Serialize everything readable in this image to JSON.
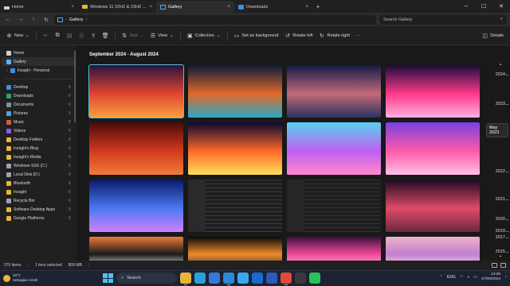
{
  "tabs": [
    {
      "label": "Home",
      "icon": "home-icon",
      "active": false
    },
    {
      "label": "Windows 11 22H2 & 23H2 Feat",
      "icon": "folder-icon",
      "active": false
    },
    {
      "label": "Gallery",
      "icon": "gallery-icon",
      "active": true
    },
    {
      "label": "Downloads",
      "icon": "downloads-icon",
      "active": false
    }
  ],
  "address": {
    "path": "Gallery",
    "search_placeholder": "Search Gallery"
  },
  "commands": {
    "new": "New",
    "sort": "Sort",
    "view": "View",
    "collection": "Collection",
    "set_background": "Set as background",
    "rotate_left": "Rotate left",
    "rotate_right": "Rotate right",
    "more": "···",
    "details": "Details"
  },
  "sidebar": {
    "top": [
      {
        "label": "Home",
        "icon": "home-icon",
        "color": "#d0d0d0",
        "active": false
      },
      {
        "label": "Gallery",
        "icon": "gallery-icon",
        "color": "#5ab0ff",
        "active": true
      },
      {
        "label": "Inzaghi - Personal",
        "icon": "onedrive-icon",
        "color": "#3e8ede",
        "active": false
      }
    ],
    "pinned": [
      {
        "label": "Desktop",
        "color": "#3e8ede"
      },
      {
        "label": "Downloads",
        "color": "#2fa36b"
      },
      {
        "label": "Documents",
        "color": "#7a8fa6"
      },
      {
        "label": "Pictures",
        "color": "#4da3e0"
      },
      {
        "label": "Music",
        "color": "#e0573e"
      },
      {
        "label": "Videos",
        "color": "#8a5ce0"
      },
      {
        "label": "Desktop Folders",
        "color": "#e8b53a"
      },
      {
        "label": "Inzaghi's Blog",
        "color": "#e8b53a"
      },
      {
        "label": "Inzaghi's Media",
        "color": "#e8b53a"
      },
      {
        "label": "Windows-SSD (C:)",
        "color": "#9aa4b0"
      },
      {
        "label": "Local Disk (D:)",
        "color": "#9aa4b0"
      },
      {
        "label": "Bluetooth",
        "color": "#e8b53a"
      },
      {
        "label": "Inzaghi",
        "color": "#e8b53a"
      },
      {
        "label": "Recycle Bin",
        "color": "#9aa4b0"
      },
      {
        "label": "Software Desktop Apps",
        "color": "#e8b53a"
      },
      {
        "label": "Google Platforms",
        "color": "#e8b53a"
      }
    ]
  },
  "main": {
    "section_title": "September 2024 - August 2024",
    "thumbnails": [
      {
        "name": "sunset-palms",
        "c1": "#2a1240",
        "c2": "#e0462e",
        "c3": "#f7a040",
        "selected": true
      },
      {
        "name": "forest-night-lake",
        "c1": "#0c1a3a",
        "c2": "#e06a2a",
        "c3": "#2aa8c8",
        "selected": false
      },
      {
        "name": "mountain-dusk",
        "c1": "#141a48",
        "c2": "#c46a7a",
        "c3": "#2a3160",
        "selected": false
      },
      {
        "name": "retro-sun-palms",
        "c1": "#1a0a3a",
        "c2": "#ff3a8a",
        "c3": "#ffb0e0",
        "selected": false
      },
      {
        "name": "red-sunset-sea",
        "c1": "#4a0a0a",
        "c2": "#d43a1e",
        "c3": "#f07a3a",
        "selected": false
      },
      {
        "name": "neon-triangle",
        "c1": "#0a0630",
        "c2": "#ff6a2a",
        "c3": "#ffe05a",
        "selected": false
      },
      {
        "name": "pastel-wave",
        "c1": "#5ad0f0",
        "c2": "#c060f0",
        "c3": "#ff8ad0",
        "selected": false
      },
      {
        "name": "purple-wave",
        "c1": "#7a40e0",
        "c2": "#ff5aa8",
        "c3": "#ffc0e8",
        "selected": false
      },
      {
        "name": "blue-wave",
        "c1": "#0a1a6a",
        "c2": "#4a7af0",
        "c3": "#d080ff",
        "selected": false
      },
      {
        "name": "code-screenshot-1",
        "c1": "#1e1e1e",
        "c2": "#2a2a2a",
        "c3": "#3a3a3a",
        "selected": false
      },
      {
        "name": "code-screenshot-2",
        "c1": "#1e1e1e",
        "c2": "#262626",
        "c3": "#333333",
        "selected": false
      },
      {
        "name": "neon-tunnel",
        "c1": "#1a0a20",
        "c2": "#e04a6a",
        "c3": "#6a2a40",
        "selected": false
      },
      {
        "name": "space-splash",
        "c1": "#f07a3a",
        "c2": "#1a1a1a",
        "c3": "#f0f0f0",
        "selected": false
      },
      {
        "name": "fluid-orange",
        "c1": "#0a0a0a",
        "c2": "#f08a2a",
        "c3": "#3a3a3a",
        "selected": false
      },
      {
        "name": "pink-flow",
        "c1": "#3a1040",
        "c2": "#f04a9a",
        "c3": "#ffb0d8",
        "selected": false
      },
      {
        "name": "pastel-mountains",
        "c1": "#f0b0c8",
        "c2": "#c080d0",
        "c3": "#ffd0e0",
        "selected": false
      }
    ]
  },
  "timeline": {
    "years": [
      {
        "label": "2024"
      },
      {
        "label": "2023"
      },
      {
        "label": "2022"
      },
      {
        "label": "2021"
      },
      {
        "label": "2020"
      },
      {
        "label": "2019"
      },
      {
        "label": "2017"
      },
      {
        "label": "2015"
      }
    ],
    "current": "May 2023"
  },
  "status": {
    "items": "270 items",
    "selected": "1 item selected",
    "size": "809 MB"
  },
  "taskbar": {
    "weather_temp": "33°C",
    "weather_text": "Sebagian cerah",
    "search": "Search",
    "apps": [
      {
        "name": "file-explorer",
        "label": "",
        "color": "#e8b53a",
        "running": true
      },
      {
        "name": "edge",
        "label": "",
        "color": "#2aa0d8",
        "running": false
      },
      {
        "name": "store",
        "label": "",
        "color": "#3a78d8",
        "running": false
      },
      {
        "name": "vscode",
        "label": "",
        "color": "#2a8ad8",
        "running": true
      },
      {
        "name": "photos",
        "label": "",
        "color": "#3aa8f0",
        "running": false
      },
      {
        "name": "outlook",
        "label": "",
        "color": "#1a6ad0",
        "running": false
      },
      {
        "name": "word",
        "label": "",
        "color": "#2a5aba",
        "running": false
      },
      {
        "name": "chrome",
        "label": "",
        "color": "#e04a3a",
        "running": true
      },
      {
        "name": "terminal",
        "label": "",
        "color": "#3a3a3a",
        "running": false
      },
      {
        "name": "whatsapp",
        "label": "",
        "color": "#2ac05a",
        "running": false
      }
    ],
    "lang": "ENG",
    "time": "14:38",
    "date": "27/09/2024"
  }
}
